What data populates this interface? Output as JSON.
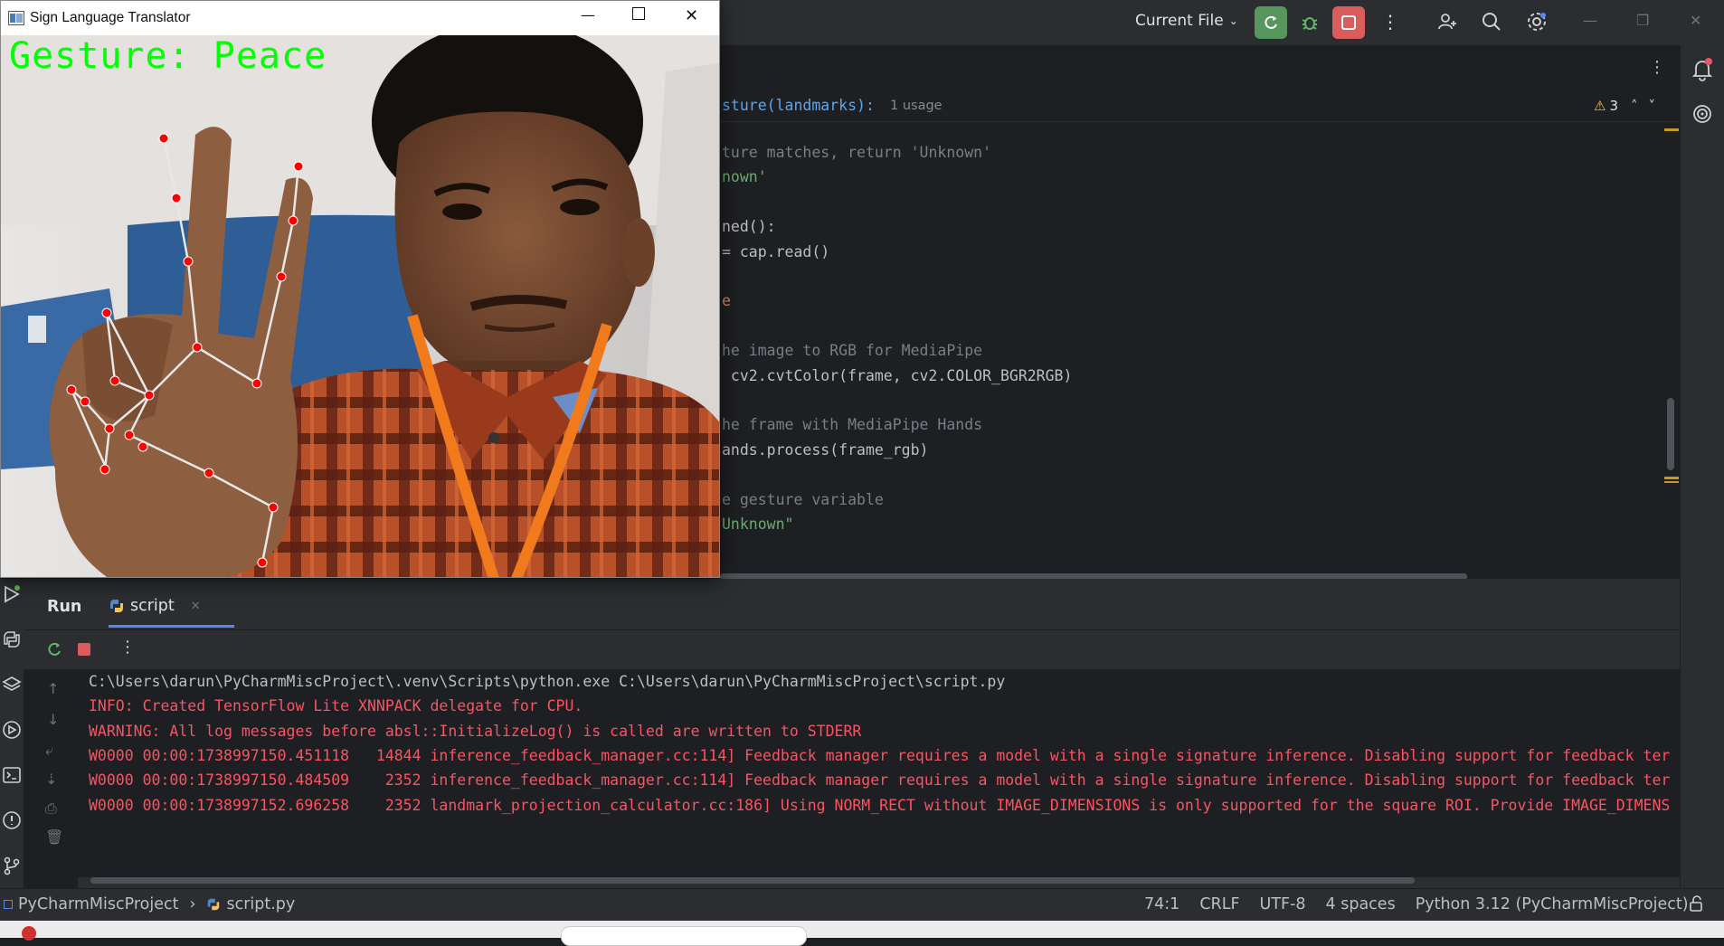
{
  "ide": {
    "run_config": "Current File",
    "breadcrumb_function": "sture(landmarks):",
    "usage_hint": "1 usage",
    "warnings_count": "3",
    "code_lines": [
      {
        "text": "ture matches, return 'Unknown'",
        "kind": "comment"
      },
      {
        "text": "nown'",
        "kind": "str"
      },
      {
        "text": "",
        "kind": "plain"
      },
      {
        "text": "ned():",
        "kind": "plain"
      },
      {
        "text": "= cap.read()",
        "kind": "plain"
      },
      {
        "text": "",
        "kind": "plain"
      },
      {
        "text": "e",
        "kind": "kw"
      },
      {
        "text": "",
        "kind": "plain"
      },
      {
        "text": "he image to RGB for MediaPipe",
        "kind": "comment"
      },
      {
        "text": " cv2.cvtColor(frame, cv2.COLOR_BGR2RGB)",
        "kind": "plain"
      },
      {
        "text": "",
        "kind": "plain"
      },
      {
        "text": "he frame with MediaPipe Hands",
        "kind": "comment"
      },
      {
        "text": "ands.process(frame_rgb)",
        "kind": "plain"
      },
      {
        "text": "",
        "kind": "plain"
      },
      {
        "text": "e gesture variable",
        "kind": "comment"
      },
      {
        "text": "Unknown\"",
        "kind": "str"
      }
    ]
  },
  "run_panel": {
    "run_tab": "Run",
    "script_tab": "script",
    "console_lines": [
      {
        "text": "C:\\Users\\darun\\PyCharmMiscProject\\.venv\\Scripts\\python.exe C:\\Users\\darun\\PyCharmMiscProject\\script.py",
        "kind": "white"
      },
      {
        "text": "INFO: Created TensorFlow Lite XNNPACK delegate for CPU.",
        "kind": "red"
      },
      {
        "text": "WARNING: All log messages before absl::InitializeLog() is called are written to STDERR",
        "kind": "red"
      },
      {
        "text": "W0000 00:00:1738997150.451118   14844 inference_feedback_manager.cc:114] Feedback manager requires a model with a single signature inference. Disabling support for feedback ter",
        "kind": "red"
      },
      {
        "text": "W0000 00:00:1738997150.484509    2352 inference_feedback_manager.cc:114] Feedback manager requires a model with a single signature inference. Disabling support for feedback ter",
        "kind": "red"
      },
      {
        "text": "W0000 00:00:1738997152.696258    2352 landmark_projection_calculator.cc:186] Using NORM_RECT without IMAGE_DIMENSIONS is only supported for the square ROI. Provide IMAGE_DIMENS",
        "kind": "red"
      }
    ]
  },
  "status_bar": {
    "project": "PyCharmMiscProject",
    "file": "script.py",
    "position": "74:1",
    "line_sep": "CRLF",
    "encoding": "UTF-8",
    "indent": "4 spaces",
    "interpreter": "Python 3.12 (PyCharmMiscProject)"
  },
  "cam_window": {
    "title": "Sign Language Translator",
    "gesture_text": "Gesture: Peace"
  },
  "colors": {
    "accent_green": "#00ff00",
    "landmark_red": "#ff0000",
    "console_red": "#f75464"
  }
}
